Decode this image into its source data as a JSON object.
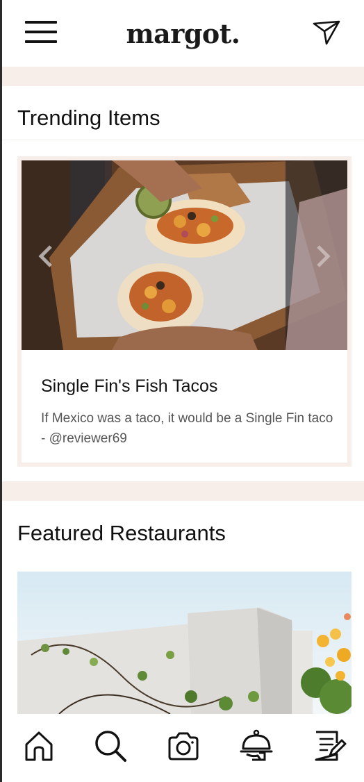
{
  "header": {
    "logo": "margot.",
    "menu_icon": "hamburger-menu-icon",
    "send_icon": "paper-plane-icon"
  },
  "trending": {
    "title": "Trending Items",
    "card": {
      "image": "tacos-photo",
      "title": "Single Fin's Fish Tacos",
      "description": "If Mexico was a taco, it would be a Single Fin taco - @reviewer69",
      "prev_icon": "chevron-left-icon",
      "next_icon": "chevron-right-icon"
    }
  },
  "featured": {
    "title": "Featured Restaurants",
    "image": "restaurant-exterior-photo"
  },
  "tabbar": {
    "items": [
      {
        "icon": "home-icon"
      },
      {
        "icon": "search-icon"
      },
      {
        "icon": "camera-icon"
      },
      {
        "icon": "cloche-icon"
      },
      {
        "icon": "notes-icon"
      }
    ]
  },
  "colors": {
    "band": "#f8eee9",
    "text": "#111111",
    "muted": "#555555"
  }
}
